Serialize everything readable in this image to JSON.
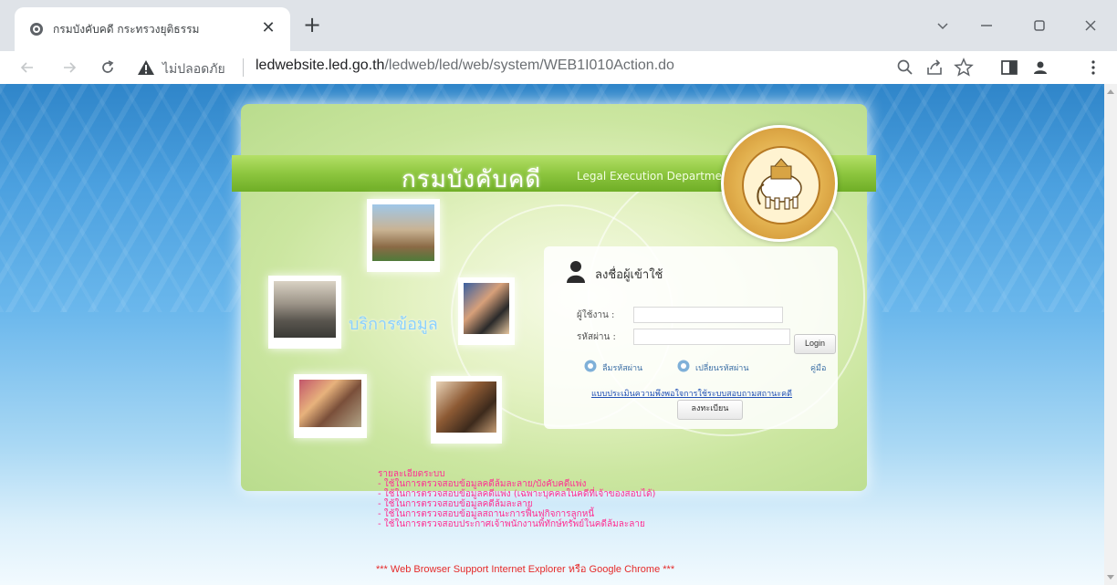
{
  "browser": {
    "tab_title": "กรมบังคับคดี กระทรวงยุติธรรม",
    "tab_close": "✕",
    "new_tab": "+",
    "not_secure": "ไม่ปลอดภัย",
    "url_host": "ledwebsite.led.go.th",
    "url_path": "/ledweb/led/web/system/WEB1I010Action.do",
    "icons": [
      "back-icon",
      "forward-icon",
      "reload-icon",
      "warning-icon",
      "zoom-icon",
      "share-icon",
      "star-icon",
      "side-panel-icon",
      "profile-icon",
      "menu-icon"
    ]
  },
  "page": {
    "banner_title": "กรมบังคับคดี",
    "banner_subtitle": "Legal Execution Department",
    "service_label": "บริการข้อมูล",
    "login": {
      "title": "ลงชื่อผู้เข้าใช้",
      "username_label": "ผู้ใช้งาน :",
      "password_label": "รหัสผ่าน :",
      "login_button": "Login",
      "forgot_password": "ลืมรหัสผ่าน",
      "change_password": "เปลี่ยนรหัสผ่าน",
      "manual": "คู่มือ",
      "survey_link": "แบบประเมินความพึงพอใจการใช้ระบบสอบถามสถานะคดี",
      "register_button": "ลงทะเบียน"
    },
    "info_lines": [
      "รายละเอียดระบบ",
      "- ใช้ในการตรวจสอบข้อมูลคดีล้มละลาย/บังคับคดีแพ่ง",
      "- ใช้ในการตรวจสอบข้อมูลคดีแพ่ง (เฉพาะบุคคลในคดีที่เจ้าของสอบได้)",
      "- ใช้ในการตรวจสอบข้อมูลคดีล้มละลาย",
      "- ใช้ในการตรวจสอบข้อมูลสถานะการฟื้นฟูกิจการลูกหนี้",
      "- ใช้ในการตรวจสอบประกาศเจ้าพนักงานพิทักษ์ทรัพย์ในคดีล้มละลาย"
    ],
    "support_text": "*** Web Browser Support  Internet Explorer หรือ Google Chrome ***"
  }
}
